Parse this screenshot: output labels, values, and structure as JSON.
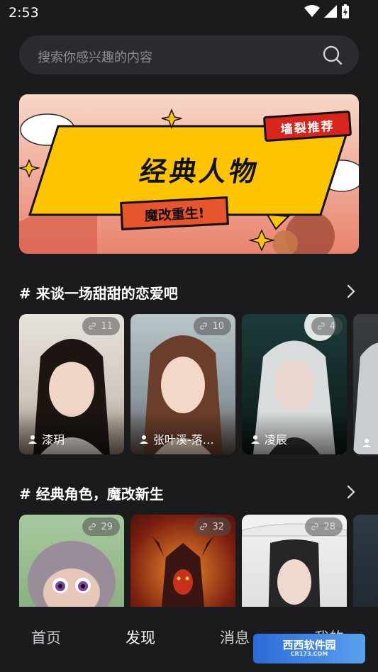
{
  "status_bar": {
    "time": "2:53",
    "icons": [
      "wifi-icon",
      "signal-icon",
      "battery-charging-icon"
    ]
  },
  "search": {
    "placeholder": "搜索你感兴趣的内容",
    "icon": "search-icon"
  },
  "banner": {
    "tag": "墙裂推荐",
    "title": "经典人物",
    "subtitle": "魔改重生!"
  },
  "sections": [
    {
      "title": "# 来谈一场甜甜的恋爱吧",
      "cards": [
        {
          "count": "11",
          "name": "漆玥"
        },
        {
          "count": "10",
          "name": "张叶溪-落…"
        },
        {
          "count": "4",
          "name": "凌辰"
        },
        {
          "count": "",
          "name": ""
        }
      ]
    },
    {
      "title": "# 经典角色，魔改新生",
      "cards": [
        {
          "count": "29",
          "name": ""
        },
        {
          "count": "32",
          "name": ""
        },
        {
          "count": "28",
          "name": ""
        },
        {
          "count": "",
          "name": ""
        }
      ]
    }
  ],
  "nav": {
    "home": "首页",
    "discover": "发现",
    "messages": "消息",
    "mine": "我的"
  },
  "watermark": {
    "text": "西西软件园",
    "url": "CR173.COM"
  }
}
